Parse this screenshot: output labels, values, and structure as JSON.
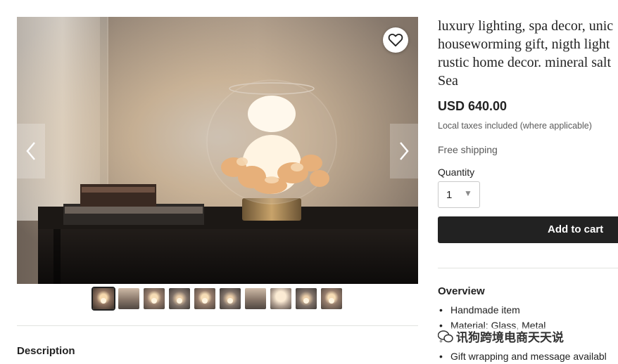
{
  "product": {
    "title_lines": [
      "luxury lighting, spa decor, unic",
      "houseworming gift, nigth light",
      "rustic home decor. mineral salt",
      "Sea"
    ],
    "price": "USD 640.00",
    "tax_note": "Local taxes included (where applicable)",
    "shipping": "Free shipping",
    "quantity_label": "Quantity",
    "quantity_value": "1",
    "add_to_cart_label": "Add to cart"
  },
  "gallery": {
    "thumbnail_count": 10,
    "active_index": 0,
    "icons": {
      "favorite": "heart-icon",
      "prev": "chevron-left-icon",
      "next": "chevron-right-icon"
    }
  },
  "overview": {
    "heading": "Overview",
    "items": [
      "Handmade item",
      "Material: Glass, Metal",
      "",
      "Gift wrapping and message availabl"
    ]
  },
  "description": {
    "heading": "Description"
  },
  "watermark": {
    "text": "讯狗跨境电商天天说"
  },
  "colors": {
    "button_bg": "#222222",
    "text": "#222222",
    "muted": "#595959",
    "divider": "#e1e3df"
  }
}
